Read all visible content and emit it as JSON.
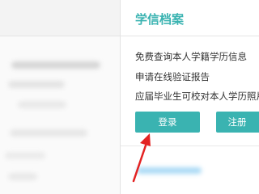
{
  "card": {
    "title": "学信档案",
    "features": [
      "免费查询本人学籍学历信息",
      "申请在线验证报告",
      "应届毕业生可校对本人学历照片"
    ],
    "login_label": "登录",
    "register_label": "注册"
  },
  "colors": {
    "accent": "#3ab3b1",
    "arrow": "#e32222"
  }
}
